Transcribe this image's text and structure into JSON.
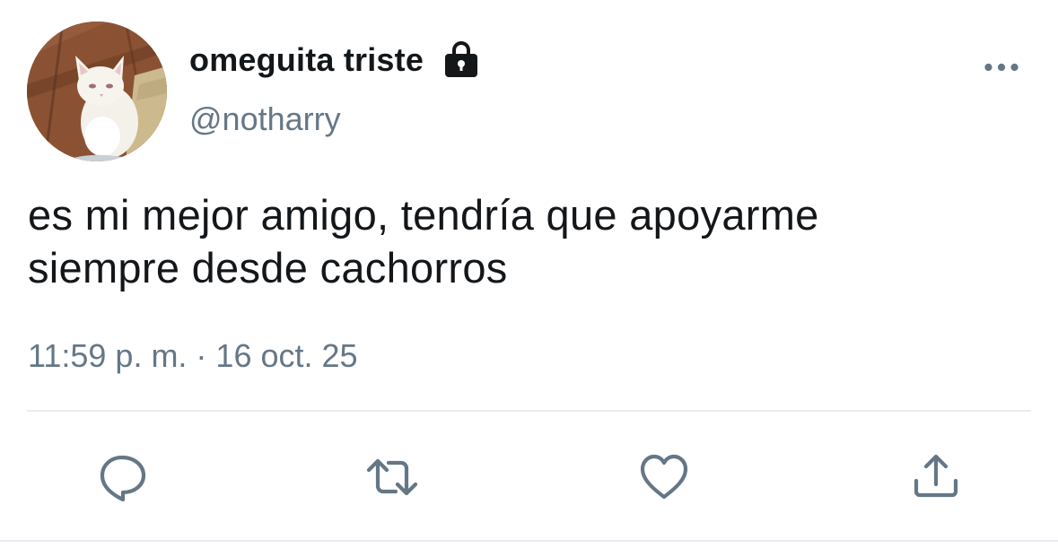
{
  "tweet": {
    "display_name": "omeguita triste",
    "handle": "@notharry",
    "protected_icon": "lock-icon",
    "more_icon": "more-horizontal-icon",
    "text_lines": [
      "es mi mejor amigo, tendría que apoyarme",
      "siempre desde cachorros"
    ],
    "timestamp": "11:59 p. m. · 16 oct. 25"
  },
  "actions": [
    {
      "name": "reply",
      "icon": "reply-icon"
    },
    {
      "name": "retweet",
      "icon": "retweet-icon"
    },
    {
      "name": "like",
      "icon": "heart-icon"
    },
    {
      "name": "share",
      "icon": "share-icon"
    }
  ],
  "colors": {
    "text_primary": "#14171a",
    "text_secondary": "#657786",
    "icon": "#657786",
    "divider": "#e6ecf0",
    "background": "#ffffff"
  }
}
